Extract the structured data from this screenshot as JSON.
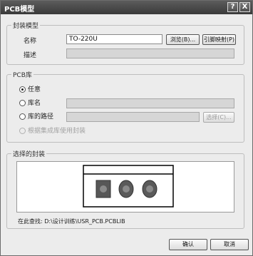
{
  "window": {
    "title": "PCB模型",
    "help_symbol": "?",
    "close_symbol": "X"
  },
  "footprint": {
    "legend": "封装模型",
    "name_label": "名称",
    "name_value": "TO-220U",
    "browse_button": "浏览(B)...",
    "pin_map_button": "引脚映射(P)",
    "description_label": "描述",
    "description_value": ""
  },
  "pcb_library": {
    "legend": "PCB库",
    "options": [
      {
        "label": "任意",
        "selected": true,
        "enabled": true
      },
      {
        "label": "库名",
        "selected": false,
        "enabled": true
      },
      {
        "label": "库的路径",
        "selected": false,
        "enabled": true
      },
      {
        "label": "根据集成库使用封装",
        "selected": false,
        "enabled": false
      }
    ],
    "library_name_value": "",
    "library_path_value": "",
    "choose_button": "选择(C)..."
  },
  "selected_footprint": {
    "legend": "选择的封装",
    "found_in": "在此查找: D:\\设计训练\\USR_PCB.PCBLIB"
  },
  "buttons": {
    "ok": "确认",
    "cancel": "取消"
  },
  "colors": {
    "titlebar": "#3f3f3f",
    "component_body": "#575757",
    "pad_outer": "#666666",
    "pad_inner": "#8a8a8a"
  }
}
